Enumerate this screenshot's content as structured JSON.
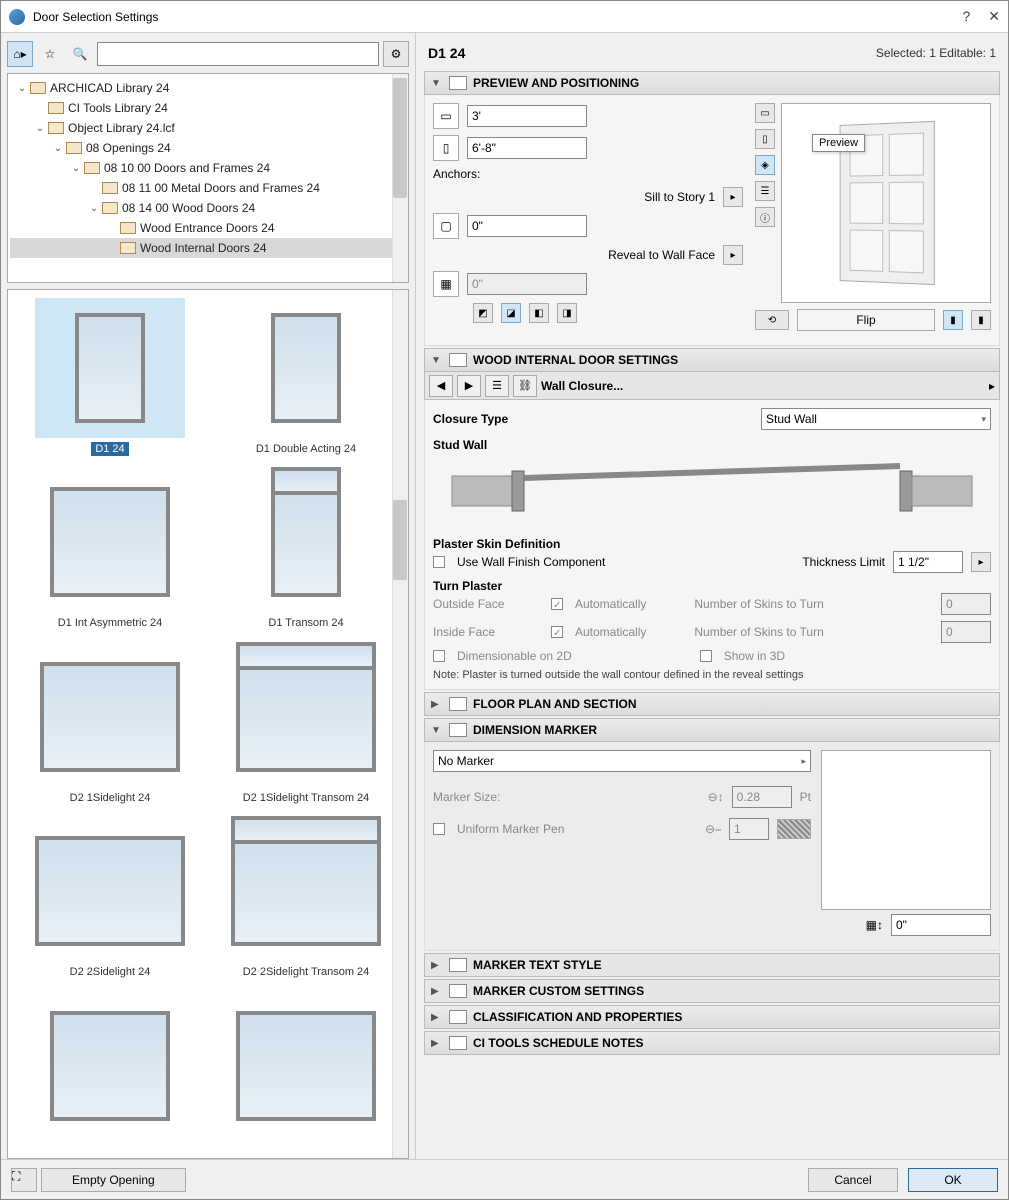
{
  "window": {
    "title": "Door Selection Settings"
  },
  "toolbar": {
    "search_value": ""
  },
  "tree": {
    "items": [
      {
        "indent": 0,
        "expanded": true,
        "label": "ARCHICAD Library 24"
      },
      {
        "indent": 1,
        "expanded": null,
        "label": "CI Tools Library 24"
      },
      {
        "indent": 1,
        "expanded": true,
        "label": "Object Library 24.lcf"
      },
      {
        "indent": 2,
        "expanded": true,
        "label": "08 Openings 24"
      },
      {
        "indent": 3,
        "expanded": true,
        "label": "08 10 00 Doors and Frames 24"
      },
      {
        "indent": 4,
        "expanded": null,
        "label": "08 11 00 Metal Doors and Frames 24"
      },
      {
        "indent": 4,
        "expanded": true,
        "label": "08 14 00 Wood Doors 24"
      },
      {
        "indent": 5,
        "expanded": null,
        "label": "Wood Entrance Doors 24"
      },
      {
        "indent": 5,
        "expanded": null,
        "label": "Wood Internal Doors 24",
        "selected": true
      }
    ]
  },
  "thumbs": [
    {
      "label": "D1 24",
      "selected": true,
      "cls": ""
    },
    {
      "label": "D1 Double Acting 24",
      "cls": ""
    },
    {
      "label": "D1 Int Asymmetric 24",
      "cls": "dbl"
    },
    {
      "label": "D1 Transom 24",
      "cls": "transom"
    },
    {
      "label": "D2 1Sidelight 24",
      "cls": "side1"
    },
    {
      "label": "D2 1Sidelight Transom 24",
      "cls": "side1 transom"
    },
    {
      "label": "D2 2Sidelight 24",
      "cls": "side2"
    },
    {
      "label": "D2 2Sidelight Transom 24",
      "cls": "side2 transom"
    },
    {
      "label": "",
      "cls": "dbl"
    },
    {
      "label": "",
      "cls": "side1"
    }
  ],
  "header": {
    "name": "D1 24",
    "status": "Selected: 1 Editable: 1"
  },
  "sections": {
    "preview": {
      "title": "Preview and Positioning",
      "width": "3'",
      "height": "6'-8\"",
      "anchors_label": "Anchors:",
      "sill_label": "Sill to Story 1",
      "sill_value": "0\"",
      "reveal_label": "Reveal to Wall Face",
      "reveal_value": "0\"",
      "flip_label": "Flip",
      "preview_tip": "Preview"
    },
    "wood": {
      "title": "Wood Internal Door Settings",
      "subnav": "Wall Closure...",
      "closure_type_label": "Closure Type",
      "closure_type_value": "Stud Wall",
      "stud_wall_label": "Stud Wall",
      "plaster_def_label": "Plaster Skin Definition",
      "use_wall_finish": "Use Wall Finish Component",
      "thickness_limit_label": "Thickness Limit",
      "thickness_limit_value": "1 1/2\"",
      "turn_plaster_label": "Turn Plaster",
      "outside_face": "Outside Face",
      "inside_face": "Inside Face",
      "automatically": "Automatically",
      "num_skins_label": "Number of Skins to Turn",
      "num_skins_value": "0",
      "dimensionable": "Dimensionable on 2D",
      "show3d": "Show in 3D",
      "note": "Note: Plaster is turned outside the wall contour defined in the reveal settings"
    },
    "floorplan": {
      "title": "Floor Plan and Section"
    },
    "dimension": {
      "title": "Dimension Marker",
      "no_marker": "No Marker",
      "marker_size_label": "Marker Size:",
      "marker_size_value": "0.28",
      "marker_size_unit": "Pt",
      "uniform_pen": "Uniform Marker Pen",
      "pen_value": "1",
      "offset_value": "0\""
    },
    "markertext": {
      "title": "Marker Text Style"
    },
    "markercustom": {
      "title": "Marker Custom Settings"
    },
    "classification": {
      "title": "Classification and Properties"
    },
    "citools": {
      "title": "CI Tools Schedule Notes"
    }
  },
  "footer": {
    "empty_opening": "Empty Opening",
    "cancel": "Cancel",
    "ok": "OK"
  }
}
